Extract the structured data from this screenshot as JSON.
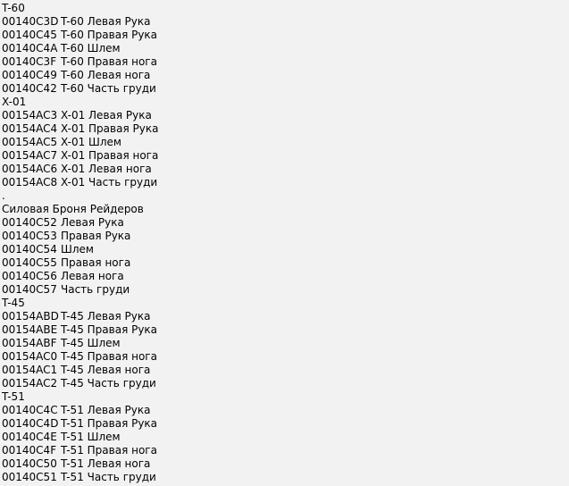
{
  "colors": {
    "background": "#f2f2f2",
    "text": "#000000"
  },
  "listing": {
    "separator_text": ".",
    "sections": [
      {
        "header": "T-60",
        "rows": [
          {
            "id": "00140C3D",
            "name": "T-60 Левая Рука"
          },
          {
            "id": "00140C45",
            "name": "T-60 Правая Рука"
          },
          {
            "id": "00140C4A",
            "name": "T-60 Шлем"
          },
          {
            "id": "00140C3F",
            "name": "T-60 Правая нога"
          },
          {
            "id": "00140C49",
            "name": "T-60 Левая нога"
          },
          {
            "id": "00140C42",
            "name": "T-60 Часть груди"
          }
        ],
        "separator_after": false
      },
      {
        "header": "X-01",
        "rows": [
          {
            "id": "00154AC3",
            "name": "X-01 Левая Рука"
          },
          {
            "id": "00154AC4",
            "name": "X-01 Правая Рука"
          },
          {
            "id": "00154AC5",
            "name": "X-01 Шлем"
          },
          {
            "id": "00154AC7",
            "name": "X-01 Правая нога"
          },
          {
            "id": "00154AC6",
            "name": "X-01 Левая нога"
          },
          {
            "id": "00154AC8",
            "name": "X-01 Часть груди"
          }
        ],
        "separator_after": true
      },
      {
        "header": "Силовая Броня Рейдеров",
        "rows": [
          {
            "id": "00140C52",
            "name": "Левая Рука"
          },
          {
            "id": "00140C53",
            "name": "Правая Рука"
          },
          {
            "id": "00140C54",
            "name": "Шлем"
          },
          {
            "id": "00140C55",
            "name": "Правая нога"
          },
          {
            "id": "00140C56",
            "name": "Левая нога"
          },
          {
            "id": "00140C57",
            "name": "Часть груди"
          }
        ],
        "separator_after": false
      },
      {
        "header": "T-45",
        "rows": [
          {
            "id": "00154ABD",
            "name": "T-45 Левая Рука"
          },
          {
            "id": "00154ABE",
            "name": "T-45 Правая Рука"
          },
          {
            "id": "00154ABF",
            "name": "T-45 Шлем"
          },
          {
            "id": "00154AC0",
            "name": "T-45 Правая нога"
          },
          {
            "id": "00154AC1",
            "name": "T-45 Левая нога"
          },
          {
            "id": "00154AC2",
            "name": "T-45 Часть груди"
          }
        ],
        "separator_after": false
      },
      {
        "header": "T-51",
        "rows": [
          {
            "id": "00140C4C",
            "name": "T-51 Левая Рука"
          },
          {
            "id": "00140C4D",
            "name": "T-51 Правая Рука"
          },
          {
            "id": "00140C4E",
            "name": "T-51 Шлем"
          },
          {
            "id": "00140C4F",
            "name": "T-51 Правая нога"
          },
          {
            "id": "00140C50",
            "name": "T-51 Левая нога"
          },
          {
            "id": "00140C51",
            "name": "T-51 Часть груди"
          }
        ],
        "separator_after": false
      }
    ]
  }
}
